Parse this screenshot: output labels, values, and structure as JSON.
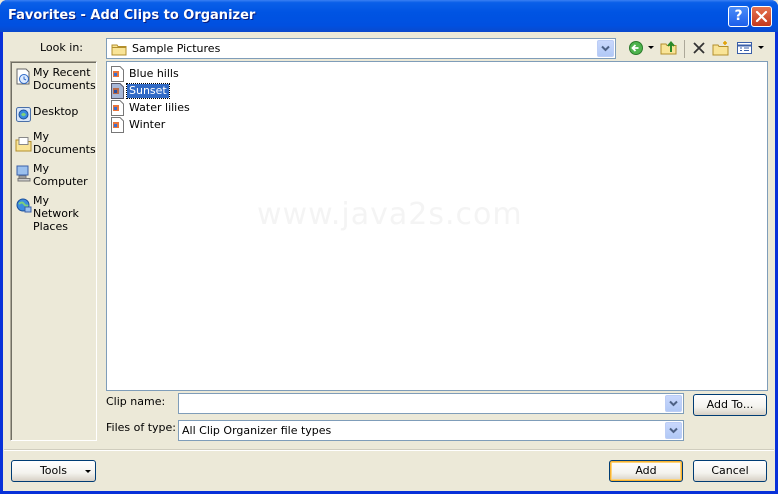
{
  "window": {
    "title": "Favorites - Add Clips to Organizer",
    "help_glyph": "?",
    "close_glyph": "✕"
  },
  "lookin": {
    "label": "Look in:",
    "value": "Sample Pictures"
  },
  "toolbar": {
    "icons": [
      "back-icon",
      "up-folder-icon",
      "delete-icon",
      "new-folder-icon",
      "views-icon"
    ]
  },
  "places": [
    {
      "label": "My Recent Documents",
      "icon": "recent-documents-icon"
    },
    {
      "label": "Desktop",
      "icon": "desktop-icon"
    },
    {
      "label": "My Documents",
      "icon": "my-documents-icon"
    },
    {
      "label": "My Computer",
      "icon": "my-computer-icon"
    },
    {
      "label": "My Network Places",
      "icon": "network-places-icon"
    }
  ],
  "files": [
    {
      "name": "Blue hills",
      "selected": false
    },
    {
      "name": "Sunset",
      "selected": true
    },
    {
      "name": "Water lilies",
      "selected": false
    },
    {
      "name": "Winter",
      "selected": false
    }
  ],
  "watermark": "www.java2s.com",
  "clip_name": {
    "label": "Clip name:",
    "value": ""
  },
  "files_of_type": {
    "label": "Files of type:",
    "value": "All Clip Organizer file types"
  },
  "buttons": {
    "add_to": "Add To...",
    "tools": "Tools",
    "add": "Add",
    "cancel": "Cancel"
  },
  "colors": {
    "titlebar": "#0054E3",
    "selection": "#316AC5",
    "dialog_bg": "#ECE9D8"
  }
}
